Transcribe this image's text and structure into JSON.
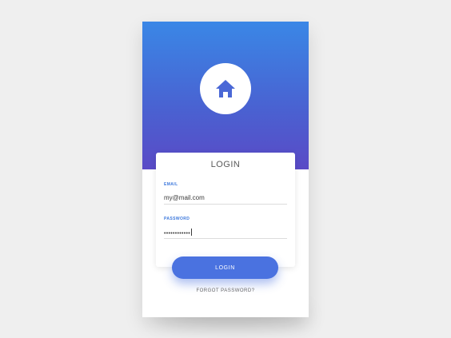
{
  "colors": {
    "gradient_top": "#3a87e6",
    "gradient_bottom": "#5a4ac6",
    "accent": "#4a72e0",
    "label": "#3c78dc"
  },
  "header": {
    "icon": "home-icon"
  },
  "card": {
    "title": "LOGIN",
    "email": {
      "label": "EMAIL",
      "value": "my@mail.com"
    },
    "password": {
      "label": "PASSWORD",
      "value": "••••••••••••"
    }
  },
  "actions": {
    "login_label": "LOGIN",
    "forgot_label": "FORGOT PASSWORD?"
  }
}
